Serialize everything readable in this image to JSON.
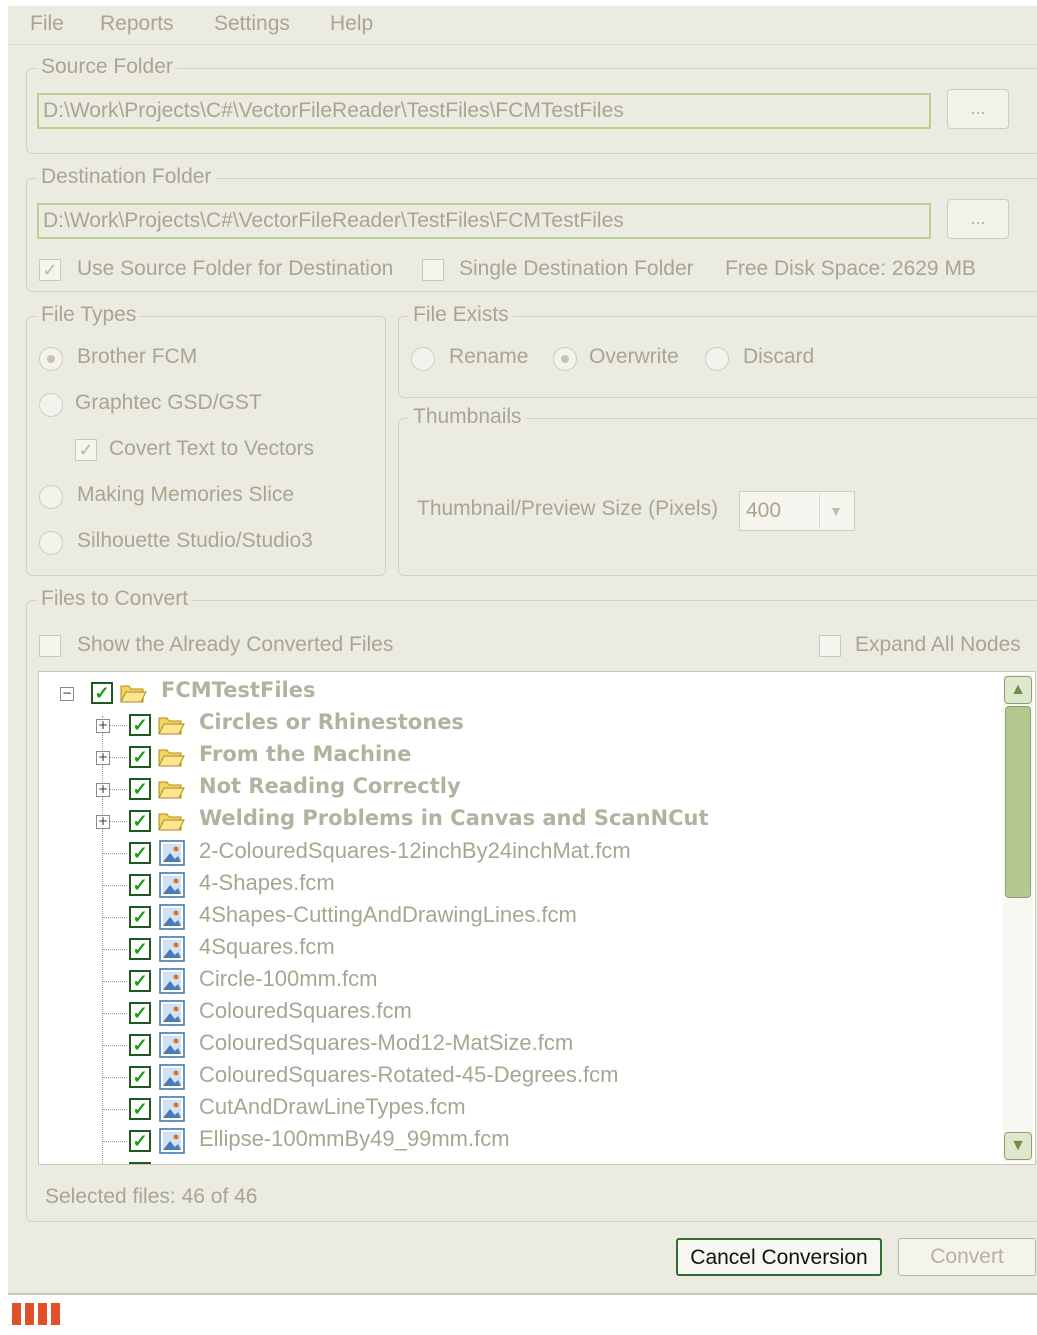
{
  "menu": [
    "File",
    "Reports",
    "Settings",
    "Help"
  ],
  "source_folder": {
    "legend": "Source Folder",
    "path": "D:\\Work\\Projects\\C#\\VectorFileReader\\TestFiles\\FCMTestFiles",
    "browse_label": "..."
  },
  "destination_folder": {
    "legend": "Destination Folder",
    "path": "D:\\Work\\Projects\\C#\\VectorFileReader\\TestFiles\\FCMTestFiles",
    "browse_label": "...",
    "use_source_label": "Use Source Folder for Destination",
    "use_source_checked": true,
    "single_dest_label": "Single Destination Folder",
    "single_dest_checked": false,
    "free_disk": "Free Disk Space: 2629 MB"
  },
  "file_types": {
    "legend": "File Types",
    "options": [
      "Brother FCM",
      "Graphtec GSD/GST",
      "Making Memories Slice",
      "Silhouette Studio/Studio3"
    ],
    "selected": "Brother FCM",
    "convert_text_label": "Covert Text to Vectors",
    "convert_text_checked": true
  },
  "file_exists": {
    "legend": "File Exists",
    "options": [
      "Rename",
      "Overwrite",
      "Discard"
    ],
    "selected": "Overwrite"
  },
  "thumbnails": {
    "legend": "Thumbnails",
    "size_label": "Thumbnail/Preview Size (Pixels)",
    "size_value": "400"
  },
  "files_to_convert": {
    "legend": "Files to Convert",
    "show_converted_label": "Show the Already Converted Files",
    "expand_all_label": "Expand All Nodes",
    "root": "FCMTestFiles",
    "folders": [
      "Circles or Rhinestones",
      "From the Machine",
      "Not Reading Correctly",
      "Welding Problems in Canvas and ScanNCut"
    ],
    "files": [
      "2-ColouredSquares-12inchBy24inchMat.fcm",
      "4-Shapes.fcm",
      "4Shapes-CuttingAndDrawingLines.fcm",
      "4Squares.fcm",
      "Circle-100mm.fcm",
      "ColouredSquares.fcm",
      "ColouredSquares-Mod12-MatSize.fcm",
      "ColouredSquares-Rotated-45-Degrees.fcm",
      "CutAndDrawLineTypes.fcm",
      "Ellipse-100mmBy49_99mm.fcm"
    ]
  },
  "status": {
    "selected_files": "Selected files: 46 of 46",
    "progress_segments": 4
  },
  "buttons": {
    "cancel": "Cancel Conversion",
    "convert": "Convert"
  }
}
